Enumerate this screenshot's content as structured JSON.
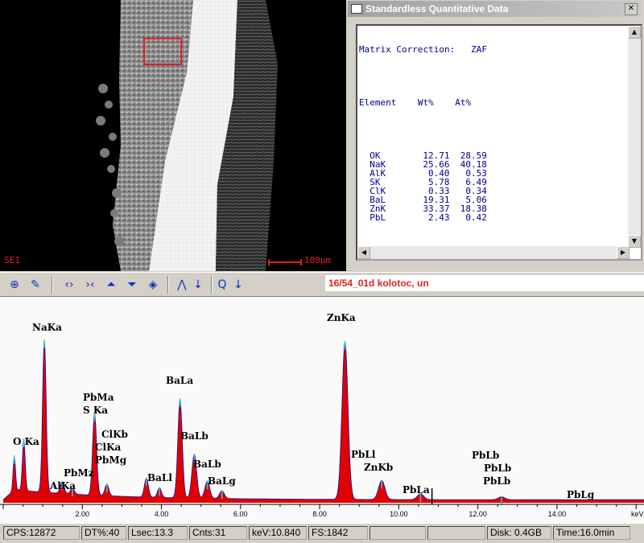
{
  "sem": {
    "mode_label": "SE1",
    "scale_label": "100µm"
  },
  "quant_window": {
    "title": "Standardless Quantitative Data",
    "matrix_label": "Matrix Correction:",
    "matrix_value": "ZAF",
    "col_element": "Element",
    "col_wt": "Wt%",
    "col_at": "At%",
    "rows": [
      {
        "el": "OK",
        "wt": "12.71",
        "at": "28.59"
      },
      {
        "el": "NaK",
        "wt": "25.66",
        "at": "40.18"
      },
      {
        "el": "AlK",
        "wt": "0.40",
        "at": "0.53"
      },
      {
        "el": "SK",
        "wt": "5.78",
        "at": "6.49"
      },
      {
        "el": "ClK",
        "wt": "0.33",
        "at": "0.34"
      },
      {
        "el": "BaL",
        "wt": "19.31",
        "at": "5.06"
      },
      {
        "el": "ZnK",
        "wt": "33.37",
        "at": "18.38"
      },
      {
        "el": "PbL",
        "wt": "2.43",
        "at": "0.42"
      }
    ]
  },
  "spectrum": {
    "name": "16/54_01d kolotoc, un",
    "fill_color": "#e00000",
    "line_color": "#1010a0",
    "fit_color": "#40c0e0",
    "cursor_kev": 10.84
  },
  "chart_data": {
    "type": "area",
    "xlabel": "keV",
    "xlim": [
      0,
      16.2
    ],
    "ylim": [
      0,
      100
    ],
    "x_ticks": [
      "2.00",
      "4.00",
      "6.00",
      "8.00",
      "10.00",
      "12.00",
      "14.00",
      "keV"
    ],
    "tick_values": [
      2,
      4,
      6,
      8,
      10,
      12,
      14
    ],
    "peaks": [
      {
        "kev": 0.28,
        "height": 18,
        "width": 0.03
      },
      {
        "kev": 0.52,
        "height": 27,
        "width": 0.035
      },
      {
        "kev": 1.04,
        "height": 80,
        "width": 0.045
      },
      {
        "kev": 1.49,
        "height": 6,
        "width": 0.05
      },
      {
        "kev": 1.75,
        "height": 3,
        "width": 0.05
      },
      {
        "kev": 2.31,
        "height": 43,
        "width": 0.05
      },
      {
        "kev": 2.62,
        "height": 6,
        "width": 0.05
      },
      {
        "kev": 3.62,
        "height": 10,
        "width": 0.05
      },
      {
        "kev": 3.95,
        "height": 5,
        "width": 0.05
      },
      {
        "kev": 4.47,
        "height": 52,
        "width": 0.055
      },
      {
        "kev": 4.83,
        "height": 23,
        "width": 0.06
      },
      {
        "kev": 5.16,
        "height": 9,
        "width": 0.06
      },
      {
        "kev": 5.53,
        "height": 4,
        "width": 0.06
      },
      {
        "kev": 8.64,
        "height": 83,
        "width": 0.075
      },
      {
        "kev": 9.57,
        "height": 10,
        "width": 0.08
      },
      {
        "kev": 10.55,
        "height": 3,
        "width": 0.08
      },
      {
        "kev": 12.6,
        "height": 1.5,
        "width": 0.08
      }
    ],
    "labels": [
      {
        "text": "O Ka",
        "kev": 0.52
      },
      {
        "text": "NaKa",
        "kev": 1.04
      },
      {
        "text": "AlKa",
        "kev": 1.49
      },
      {
        "text": "PbMz",
        "kev": 1.75
      },
      {
        "text": "PbMa",
        "kev": 2.34
      },
      {
        "text": "S Ka",
        "kev": 2.31
      },
      {
        "text": "ClKb",
        "kev": 2.82
      },
      {
        "text": "ClKa",
        "kev": 2.62
      },
      {
        "text": "PbMg",
        "kev": 2.65
      },
      {
        "text": "BaLl",
        "kev": 3.95
      },
      {
        "text": "BaLa",
        "kev": 4.47
      },
      {
        "text": "BaLb",
        "kev": 4.83
      },
      {
        "text": "BaLb",
        "kev": 5.16
      },
      {
        "text": "BaLg",
        "kev": 5.53
      },
      {
        "text": "ZnKa",
        "kev": 8.64
      },
      {
        "text": "PbLl",
        "kev": 9.18
      },
      {
        "text": "ZnKb",
        "kev": 9.57
      },
      {
        "text": "PbLa",
        "kev": 10.55
      },
      {
        "text": "PbLb",
        "kev": 12.6
      },
      {
        "text": "PbLb",
        "kev": 12.6
      },
      {
        "text": "PbLb",
        "kev": 12.6
      },
      {
        "text": "PbLg",
        "kev": 14.76
      }
    ]
  },
  "status": {
    "cps": "CPS:12872",
    "dt": "DT%:40",
    "lsec": "Lsec:13.3",
    "cnts": "Cnts:31",
    "kev": "keV:10.840",
    "fs": "FS:1842",
    "disk": "Disk: 0.4GB",
    "time": "Time:16.0min"
  },
  "toolbar_icons": [
    "probe-icon",
    "brush-icon",
    "expand-icon",
    "contract-icon",
    "peak-up-icon",
    "peak-down-icon",
    "eraser-icon",
    "spectrum-icon",
    "arrow-down-icon",
    "zoom-icon",
    "arrow-down-icon"
  ]
}
